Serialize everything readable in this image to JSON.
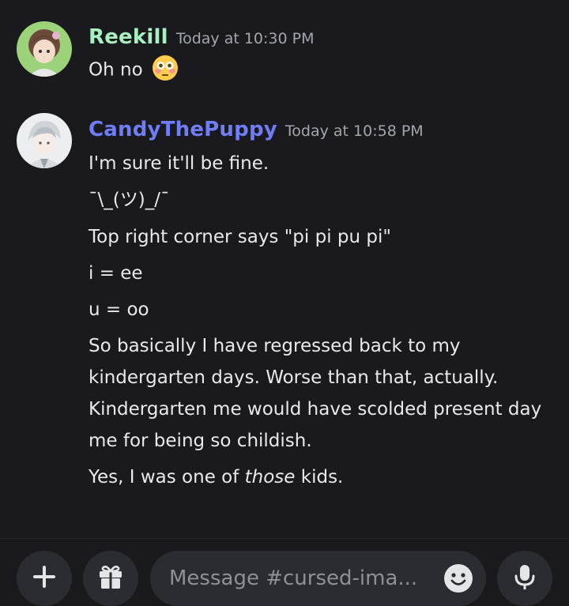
{
  "messages": [
    {
      "author": "Reekill",
      "author_color": "#a8f0c0",
      "timestamp": "Today at 10:30 PM",
      "lines": [
        "Oh no"
      ],
      "emoji": "flushed-face"
    },
    {
      "author": "CandyThePuppy",
      "author_color": "#6f7df7",
      "timestamp": "Today at 10:58 PM",
      "lines": [
        "I'm sure it'll be fine.",
        "¯\\_(ツ)_/¯",
        "Top right corner says \"pi pi pu pi\"",
        "i = ee",
        "u = oo",
        "So basically I have regressed back to my kindergarten days. Worse than that, actually. Kindergarten me would have scolded present day me for being so childish."
      ],
      "last_line": {
        "before": "Yes, I was one of ",
        "emphasis": "those",
        "after": " kids."
      }
    }
  ],
  "composer": {
    "placeholder": "Message #cursed-ima...",
    "buttons": [
      "plus-icon",
      "gift-icon",
      "emoji-icon",
      "microphone-icon"
    ]
  }
}
